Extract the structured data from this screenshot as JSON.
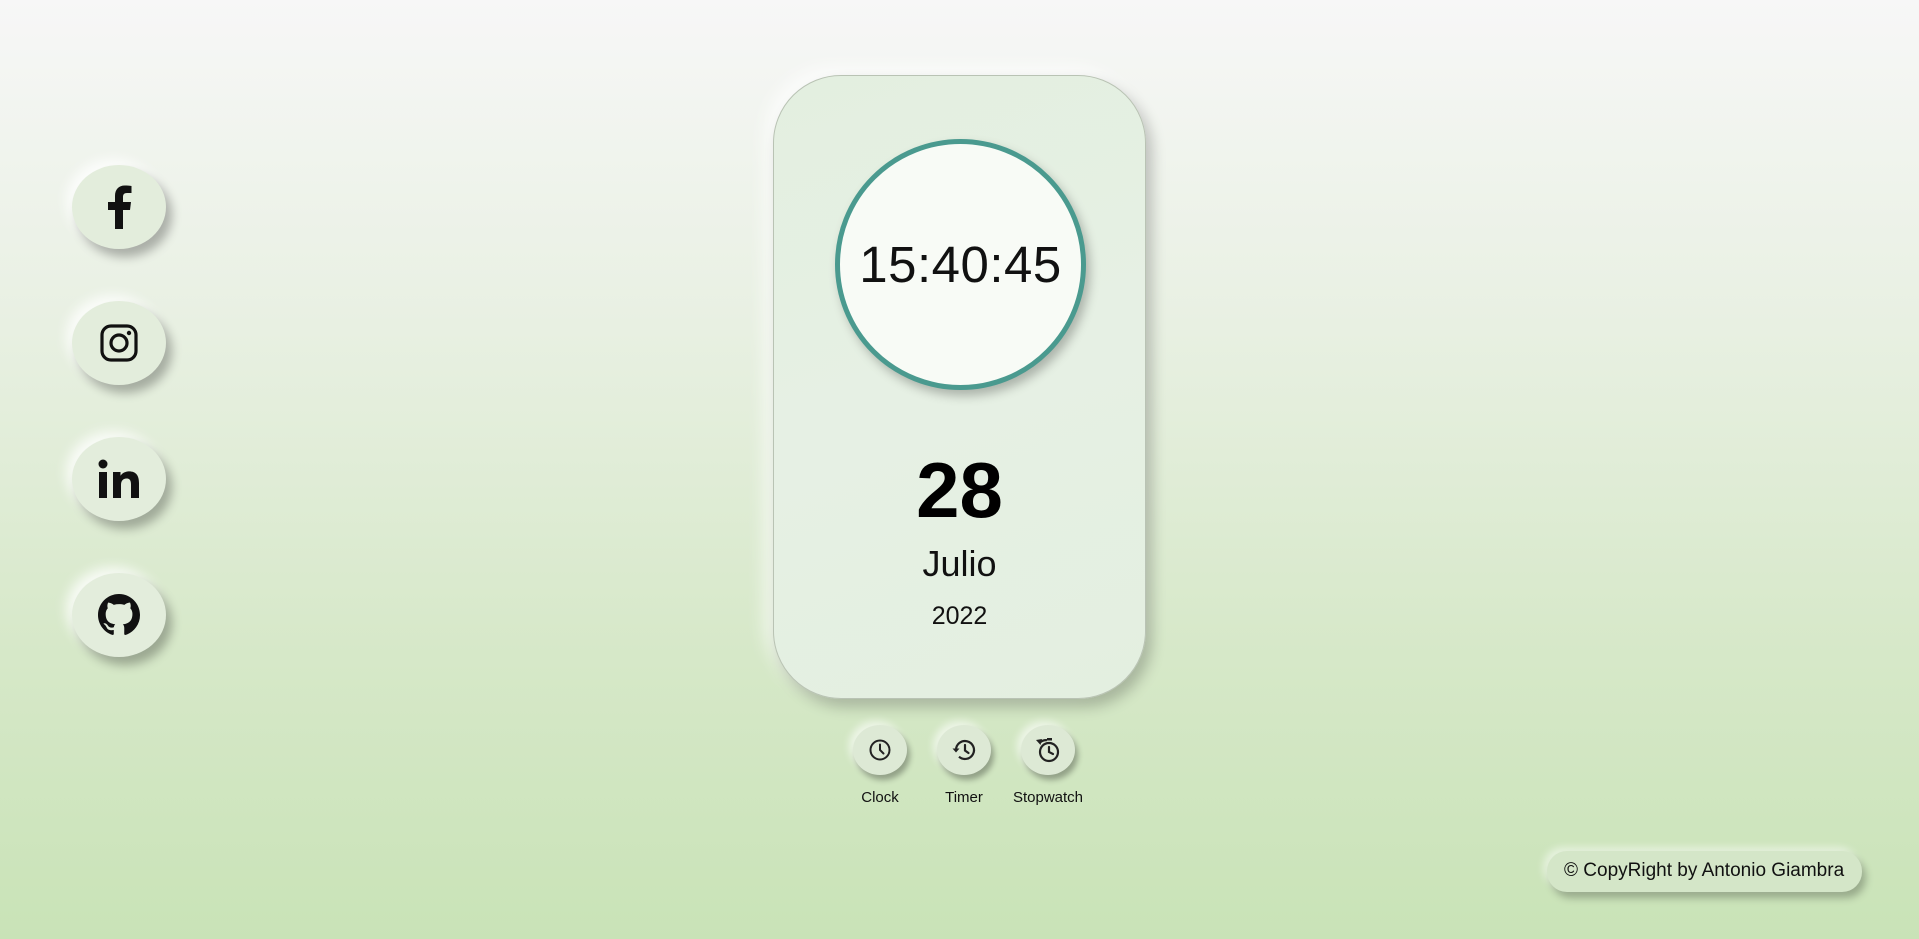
{
  "social": [
    {
      "name": "facebook",
      "icon": "facebook-icon"
    },
    {
      "name": "instagram",
      "icon": "instagram-icon"
    },
    {
      "name": "linkedin",
      "icon": "linkedin-icon"
    },
    {
      "name": "github",
      "icon": "github-icon"
    }
  ],
  "clock": {
    "time": "15:40:45",
    "day": "28",
    "month": "Julio",
    "year": "2022"
  },
  "modes": [
    {
      "label": "Clock",
      "icon": "clock-icon"
    },
    {
      "label": "Timer",
      "icon": "history-icon"
    },
    {
      "label": "Stopwatch",
      "icon": "stopwatch-icon"
    }
  ],
  "footer": {
    "copyright": "© CopyRight by Antonio Giambra"
  },
  "colors": {
    "accent": "#4a9a8f",
    "card": "#e4efe1"
  }
}
